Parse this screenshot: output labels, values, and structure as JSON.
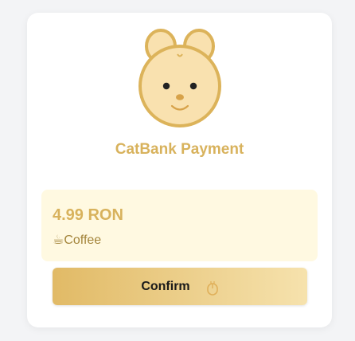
{
  "header": {
    "title": "CatBank Payment",
    "avatar_icon": "cat-face-icon"
  },
  "payment": {
    "amount": "4.99 RON",
    "description": "☕Coffee"
  },
  "actions": {
    "confirm_label": "Confirm",
    "confirm_icon": "paw-icon"
  },
  "colors": {
    "accent": "#d8b25c",
    "panel_background": "#fff9e1",
    "button_gradient_start": "#e1ba66",
    "button_gradient_end": "#f6e2ad"
  }
}
